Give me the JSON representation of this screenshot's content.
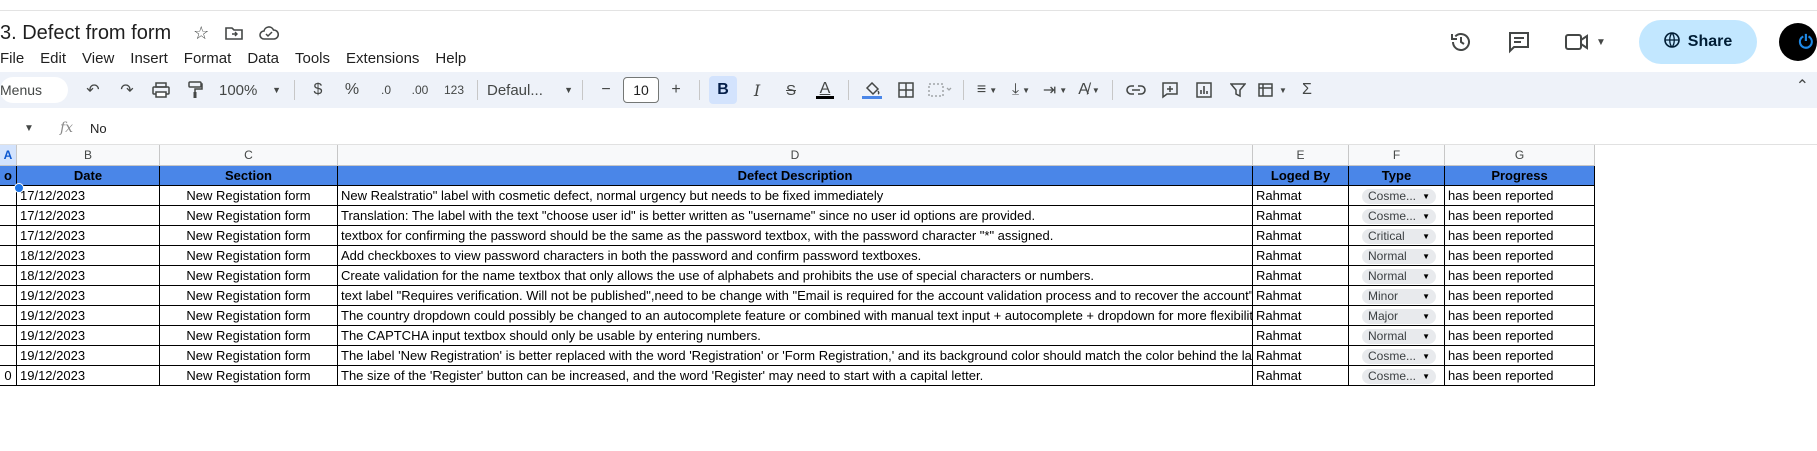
{
  "title": "3. Defect from form",
  "menus": [
    "File",
    "Edit",
    "View",
    "Insert",
    "Format",
    "Data",
    "Tools",
    "Extensions",
    "Help"
  ],
  "share_label": "Share",
  "toolbar": {
    "menus_label": "Menus",
    "zoom": "100%",
    "currency": "$",
    "percent": "%",
    "dec_decrease": ".0",
    "dec_increase": ".00",
    "number_format": "123",
    "font": "Defaul...",
    "font_size": "10",
    "minus": "−",
    "plus": "+",
    "bold": "B",
    "italic": "I",
    "text_color": "A"
  },
  "formula": {
    "fx": "fx",
    "value": "No"
  },
  "column_letters": [
    "A",
    "B",
    "C",
    "D",
    "E",
    "F",
    "G"
  ],
  "headers": [
    "o",
    "Date",
    "Section",
    "Defect Description",
    "Loged By",
    "Type",
    "Progress"
  ],
  "rows": [
    {
      "no": "",
      "date": "17/12/2023",
      "section": "New Registation form",
      "desc": "New Realstratio\" label with cosmetic defect, normal urgency but needs to be fixed immediately",
      "by": "Rahmat",
      "type": "Cosme...",
      "progress": "has been reported"
    },
    {
      "no": "",
      "date": "17/12/2023",
      "section": "New Registation form",
      "desc": "Translation: The label with the text \"choose user id\" is better written as \"username\" since no user id options are provided.",
      "by": "Rahmat",
      "type": "Cosme...",
      "progress": "has been reported"
    },
    {
      "no": "",
      "date": "17/12/2023",
      "section": "New Registation form",
      "desc": "textbox for confirming the password should be the same as the password textbox, with the password character \"*\" assigned.",
      "by": "Rahmat",
      "type": "Critical",
      "progress": "has been reported"
    },
    {
      "no": "",
      "date": "18/12/2023",
      "section": "New Registation form",
      "desc": "Add checkboxes to view password characters in both the password and confirm password textboxes.",
      "by": "Rahmat",
      "type": "Normal",
      "progress": "has been reported"
    },
    {
      "no": "",
      "date": "18/12/2023",
      "section": "New Registation form",
      "desc": "Create validation for the name textbox that only allows the use of alphabets and prohibits the use of special characters or numbers.",
      "by": "Rahmat",
      "type": "Normal",
      "progress": "has been reported"
    },
    {
      "no": "",
      "date": "19/12/2023",
      "section": "New Registation form",
      "desc": "text label \"Requires verification. Will not be published\",need to be change with \"Email is required for the account validation process and to recover the account\"",
      "by": "Rahmat",
      "type": "Minor",
      "progress": "has been reported"
    },
    {
      "no": "",
      "date": "19/12/2023",
      "section": "New Registation form",
      "desc": "The country dropdown could possibly be changed to an autocomplete feature or combined with manual text input + autocomplete + dropdown for more flexibility.",
      "by": "Rahmat",
      "type": "Major",
      "progress": "has been reported"
    },
    {
      "no": "",
      "date": "19/12/2023",
      "section": "New Registation form",
      "desc": "The CAPTCHA input textbox should only be usable by entering numbers.",
      "by": "Rahmat",
      "type": "Normal",
      "progress": "has been reported"
    },
    {
      "no": "",
      "date": "19/12/2023",
      "section": "New Registation form",
      "desc": "The label 'New Registration' is better replaced with the word 'Registration' or 'Form Registration,' and its background color should match the color behind the label text.",
      "by": "Rahmat",
      "type": "Cosme...",
      "progress": "has been reported"
    },
    {
      "no": "0",
      "date": "19/12/2023",
      "section": "New Registation form",
      "desc": "The size of the 'Register' button can be increased, and the word 'Register' may need to start with a capital letter.",
      "by": "Rahmat",
      "type": "Cosme...",
      "progress": "has been reported"
    }
  ],
  "colors": {
    "header_fill": "#4a86e8",
    "share_bg": "#c2e7ff",
    "toolbar_bg": "#eef2f9"
  }
}
